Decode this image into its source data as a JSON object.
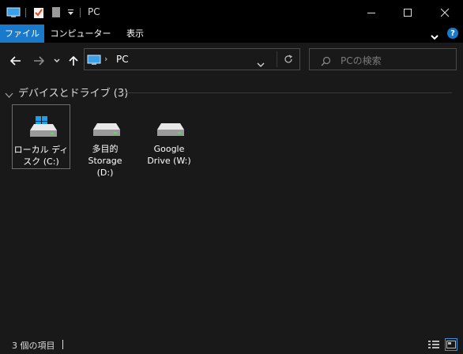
{
  "window": {
    "title": "PC"
  },
  "ribbon": {
    "tabs": [
      {
        "label": "ファイル",
        "active": true
      },
      {
        "label": "コンピューター",
        "active": false
      },
      {
        "label": "表示",
        "active": false
      }
    ]
  },
  "address": {
    "crumb": "PC"
  },
  "search": {
    "placeholder": "PCの検索"
  },
  "group": {
    "title": "デバイスとドライブ (3)"
  },
  "drives": [
    {
      "line1": "ローカル ディ",
      "line2": "スク (C:)",
      "line3": "",
      "selected": true,
      "icon": "windows-drive-icon"
    },
    {
      "line1": "多目的",
      "line2": "Storage",
      "line3": "(D:)",
      "selected": false,
      "icon": "drive-icon"
    },
    {
      "line1": "Google",
      "line2": "Drive (W:)",
      "line3": "",
      "selected": false,
      "icon": "drive-icon"
    }
  ],
  "status": {
    "text": "3 個の項目"
  },
  "colors": {
    "accent": "#1979ca",
    "background": "#191919",
    "titlebar": "#000000"
  }
}
